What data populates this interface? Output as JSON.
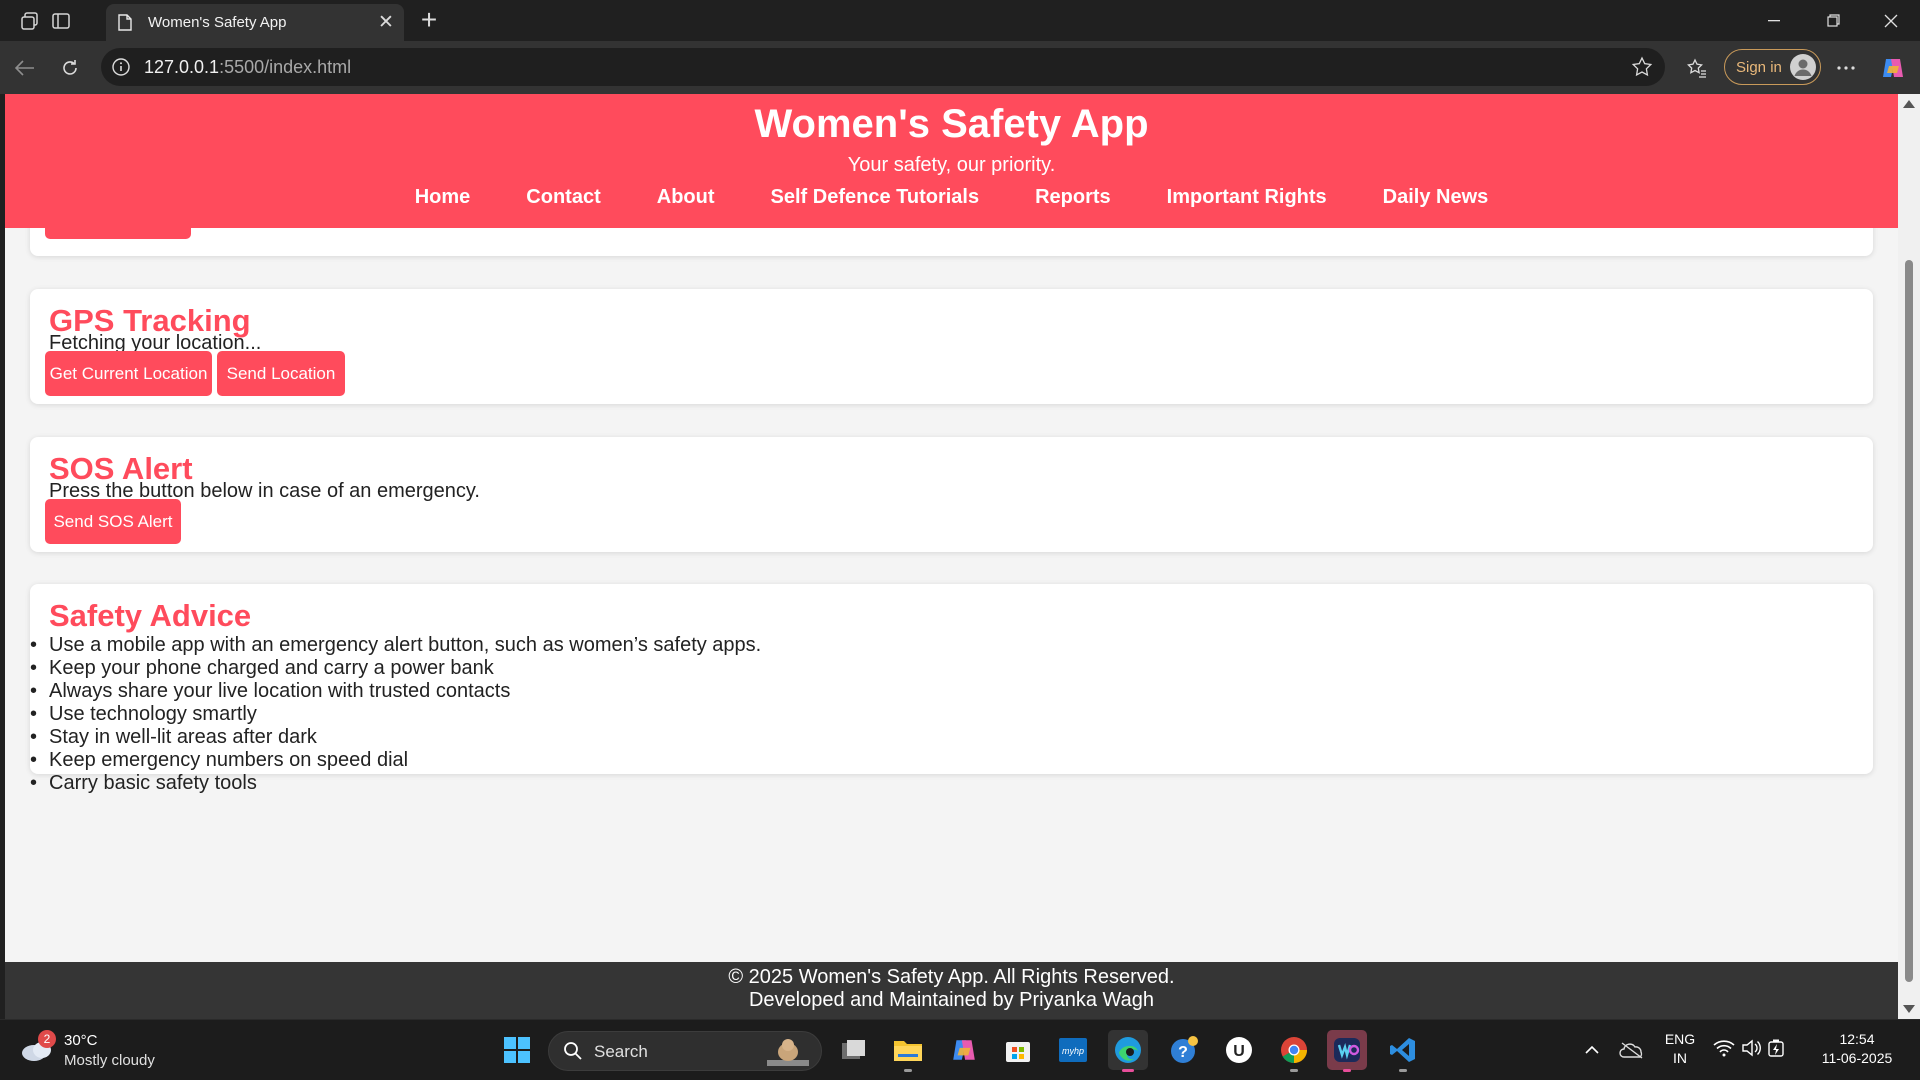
{
  "browser": {
    "tab_title": "Women's Safety App",
    "url_host": "127.0.0.1",
    "url_path": ":5500/index.html",
    "sign_in_label": "Sign in"
  },
  "site": {
    "title": "Women's Safety App",
    "tagline": "Your safety, our priority.",
    "nav": [
      "Home",
      "Contact",
      "About",
      "Self Defence Tutorials",
      "Reports",
      "Important Rights",
      "Daily News"
    ],
    "accent_color": "#ff4b5c"
  },
  "gps": {
    "heading": "GPS Tracking",
    "status": "Fetching your location...",
    "get_location_label": "Get Current Location",
    "send_location_label": "Send Location"
  },
  "sos": {
    "heading": "SOS Alert",
    "description": "Press the button below in case of an emergency.",
    "button_label": "Send SOS Alert"
  },
  "advice": {
    "heading": "Safety Advice",
    "items": [
      "Use a mobile app with an emergency alert button, such as women’s safety apps.",
      "Keep your phone charged and carry a power bank",
      "Always share your live location with trusted contacts",
      "Use technology smartly",
      "Stay in well-lit areas after dark",
      "Keep emergency numbers on speed dial",
      "Carry basic safety tools"
    ]
  },
  "footer": {
    "copyright": "© 2025 Women's Safety App. All Rights Reserved.",
    "credit": "Developed and Maintained by Priyanka Wagh"
  },
  "taskbar": {
    "weather_badge": "2",
    "weather_temp": "30°C",
    "weather_desc": "Mostly cloudy",
    "search_label": "Search",
    "lang_top": "ENG",
    "lang_bottom": "IN",
    "time": "12:54",
    "date": "11-06-2025"
  }
}
